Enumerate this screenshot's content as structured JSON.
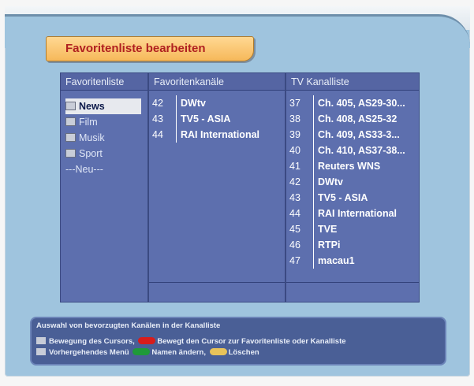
{
  "title": "Favoritenliste bearbeiten",
  "columns": {
    "favlist_header": "Favoritenliste",
    "favchannels_header": "Favoritenkanäle",
    "tvlist_header": "TV Kanalliste"
  },
  "favorites": [
    {
      "label": "News",
      "selected": true
    },
    {
      "label": "Film",
      "selected": false
    },
    {
      "label": "Musik",
      "selected": false
    },
    {
      "label": "Sport",
      "selected": false
    },
    {
      "label": "---Neu---",
      "selected": false
    }
  ],
  "favorite_channels": [
    {
      "num": "42",
      "name": "DWtv"
    },
    {
      "num": "43",
      "name": "TV5 - ASIA"
    },
    {
      "num": "44",
      "name": "RAI International"
    }
  ],
  "tv_channels": [
    {
      "num": "37",
      "name": "Ch. 405, AS29-30..."
    },
    {
      "num": "38",
      "name": "Ch. 408, AS25-32"
    },
    {
      "num": "39",
      "name": "Ch. 409,  AS33-3..."
    },
    {
      "num": "40",
      "name": "Ch. 410, AS37-38..."
    },
    {
      "num": "41",
      "name": "Reuters WNS"
    },
    {
      "num": "42",
      "name": "DWtv"
    },
    {
      "num": "43",
      "name": "TV5 - ASIA"
    },
    {
      "num": "44",
      "name": "RAI International"
    },
    {
      "num": "45",
      "name": "TVE"
    },
    {
      "num": "46",
      "name": "RTPi"
    },
    {
      "num": "47",
      "name": "macau1"
    }
  ],
  "help": {
    "line1": "Auswahl von bevorzugten Kanälen in der Kanalliste",
    "cursor_text": "Bewegung des Cursors,",
    "red_text": "Bewegt den Cursor zur Favoritenliste oder Kanalliste",
    "menu_text": "Vorhergehendes Menü",
    "green_text": "Namen ändern,",
    "yellow_text": "Löschen"
  },
  "colors": {
    "red": "#d81c1c",
    "green": "#1f9a3a",
    "yellow": "#e8c35a"
  }
}
